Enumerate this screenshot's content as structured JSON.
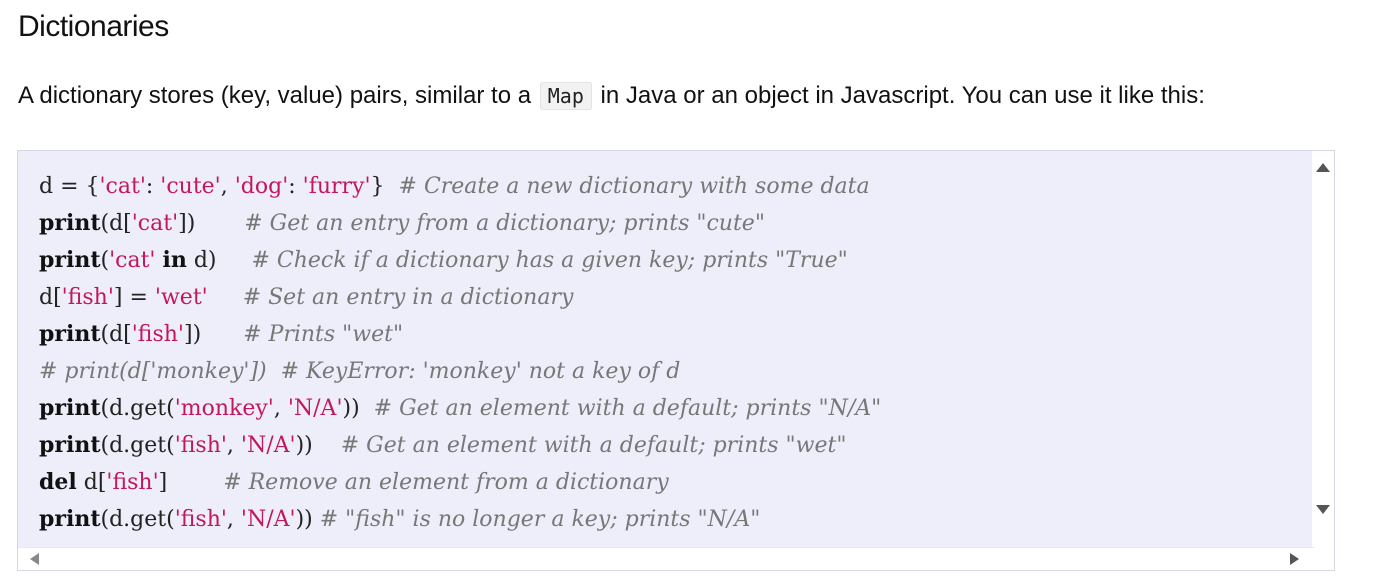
{
  "heading": "Dictionaries",
  "intro": {
    "before": "A dictionary stores (key, value) pairs, similar to a ",
    "code": "Map",
    "after": " in Java or an object in Javascript. You can use it like this:"
  },
  "code_lines": [
    [
      {
        "t": "d = {",
        "c": "p"
      },
      {
        "t": "'cat'",
        "c": "str"
      },
      {
        "t": ": ",
        "c": "p"
      },
      {
        "t": "'cute'",
        "c": "str"
      },
      {
        "t": ", ",
        "c": "p"
      },
      {
        "t": "'dog'",
        "c": "str"
      },
      {
        "t": ": ",
        "c": "p"
      },
      {
        "t": "'furry'",
        "c": "str"
      },
      {
        "t": "}  ",
        "c": "p"
      },
      {
        "t": "# Create a new dictionary with some data",
        "c": "cm"
      }
    ],
    [
      {
        "t": "print",
        "c": "kw"
      },
      {
        "t": "(d[",
        "c": "p"
      },
      {
        "t": "'cat'",
        "c": "str"
      },
      {
        "t": "])       ",
        "c": "p"
      },
      {
        "t": "# Get an entry from a dictionary; prints \"cute\"",
        "c": "cm"
      }
    ],
    [
      {
        "t": "print",
        "c": "kw"
      },
      {
        "t": "(",
        "c": "p"
      },
      {
        "t": "'cat'",
        "c": "str"
      },
      {
        "t": " ",
        "c": "p"
      },
      {
        "t": "in",
        "c": "kw"
      },
      {
        "t": " d)     ",
        "c": "p"
      },
      {
        "t": "# Check if a dictionary has a given key; prints \"True\"",
        "c": "cm"
      }
    ],
    [
      {
        "t": "d[",
        "c": "p"
      },
      {
        "t": "'fish'",
        "c": "str"
      },
      {
        "t": "] = ",
        "c": "p"
      },
      {
        "t": "'wet'",
        "c": "str"
      },
      {
        "t": "     ",
        "c": "p"
      },
      {
        "t": "# Set an entry in a dictionary",
        "c": "cm"
      }
    ],
    [
      {
        "t": "print",
        "c": "kw"
      },
      {
        "t": "(d[",
        "c": "p"
      },
      {
        "t": "'fish'",
        "c": "str"
      },
      {
        "t": "])      ",
        "c": "p"
      },
      {
        "t": "# Prints \"wet\"",
        "c": "cm"
      }
    ],
    [
      {
        "t": "# print(d['monkey'])  # KeyError: 'monkey' not a key of d",
        "c": "cm"
      }
    ],
    [
      {
        "t": "print",
        "c": "kw"
      },
      {
        "t": "(d.get(",
        "c": "p"
      },
      {
        "t": "'monkey'",
        "c": "str"
      },
      {
        "t": ", ",
        "c": "p"
      },
      {
        "t": "'N/A'",
        "c": "str"
      },
      {
        "t": "))  ",
        "c": "p"
      },
      {
        "t": "# Get an element with a default; prints \"N/A\"",
        "c": "cm"
      }
    ],
    [
      {
        "t": "print",
        "c": "kw"
      },
      {
        "t": "(d.get(",
        "c": "p"
      },
      {
        "t": "'fish'",
        "c": "str"
      },
      {
        "t": ", ",
        "c": "p"
      },
      {
        "t": "'N/A'",
        "c": "str"
      },
      {
        "t": "))    ",
        "c": "p"
      },
      {
        "t": "# Get an element with a default; prints \"wet\"",
        "c": "cm"
      }
    ],
    [
      {
        "t": "del",
        "c": "kw"
      },
      {
        "t": " d[",
        "c": "p"
      },
      {
        "t": "'fish'",
        "c": "str"
      },
      {
        "t": "]        ",
        "c": "p"
      },
      {
        "t": "# Remove an element from a dictionary",
        "c": "cm"
      }
    ],
    [
      {
        "t": "print",
        "c": "kw"
      },
      {
        "t": "(d.get(",
        "c": "p"
      },
      {
        "t": "'fish'",
        "c": "str"
      },
      {
        "t": ", ",
        "c": "p"
      },
      {
        "t": "'N/A'",
        "c": "str"
      },
      {
        "t": ")) ",
        "c": "p"
      },
      {
        "t": "# \"fish\" is no longer a key; prints \"N/A\"",
        "c": "cm"
      }
    ]
  ],
  "scroll_icons": {
    "up": "scroll-up-arrow-icon",
    "down": "scroll-down-arrow-icon",
    "left": "scroll-left-arrow-icon",
    "right": "scroll-right-arrow-icon"
  },
  "colors": {
    "code_background": "#eeeefa",
    "string": "#c2185b",
    "comment": "#777777"
  }
}
